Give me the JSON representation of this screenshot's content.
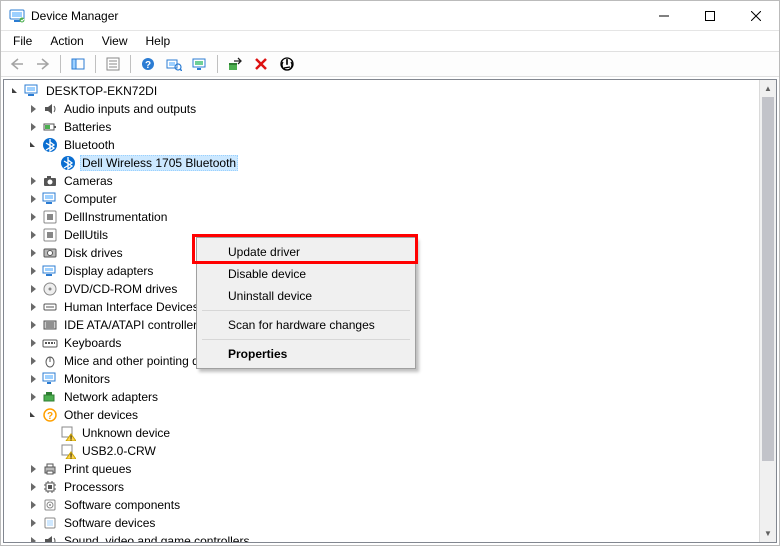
{
  "window": {
    "title": "Device Manager"
  },
  "menu": {
    "file": "File",
    "action": "Action",
    "view": "View",
    "help": "Help"
  },
  "tree": {
    "root": "DESKTOP-EKN72DI",
    "audio": "Audio inputs and outputs",
    "batteries": "Batteries",
    "bluetooth": "Bluetooth",
    "bt_device": "Dell Wireless 1705 Bluetooth",
    "cameras": "Cameras",
    "computer": "Computer",
    "dellinstr": "DellInstrumentation",
    "dellutils": "DellUtils",
    "diskdrives": "Disk drives",
    "display": "Display adapters",
    "dvd": "DVD/CD-ROM drives",
    "hid": "Human Interface Devices",
    "ide": "IDE ATA/ATAPI controllers",
    "keyboards": "Keyboards",
    "mice": "Mice and other pointing devices",
    "monitors": "Monitors",
    "network": "Network adapters",
    "other": "Other devices",
    "unknown": "Unknown device",
    "usb2crw": "USB2.0-CRW",
    "printq": "Print queues",
    "processors": "Processors",
    "swcomp": "Software components",
    "swdev": "Software devices",
    "svgc": "Sound, video and game controllers"
  },
  "context_menu": {
    "update": "Update driver",
    "disable": "Disable device",
    "uninstall": "Uninstall device",
    "scan": "Scan for hardware changes",
    "properties": "Properties"
  },
  "icons": {
    "app": "device-manager",
    "back": "back",
    "forward": "forward",
    "show": "show-hide",
    "properties": "properties",
    "help": "help",
    "hwscan": "scan-hardware",
    "enable": "monitor-enable",
    "addhw": "add-hardware",
    "remove": "remove",
    "updatedrv": "update-driver"
  }
}
